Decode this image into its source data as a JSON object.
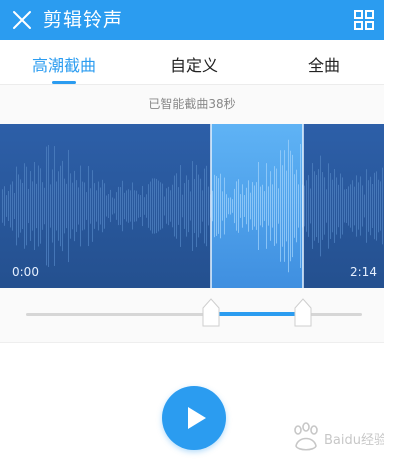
{
  "header": {
    "title": "剪辑铃声",
    "close_icon": "close-icon",
    "menu_icon": "grid-icon",
    "color": "#2b9cf0"
  },
  "tabs": [
    {
      "label": "高潮截曲",
      "active": true
    },
    {
      "label": "自定义",
      "active": false
    },
    {
      "label": "全曲",
      "active": false
    }
  ],
  "hint": "已智能截曲38秒",
  "waveform": {
    "start_time": "0:00",
    "end_time": "2:14",
    "background": "#2a5aa3",
    "selection_color": "#4aa3ee"
  },
  "player": {
    "play_icon": "play-icon"
  },
  "watermark": {
    "text": "Baidu经验"
  }
}
